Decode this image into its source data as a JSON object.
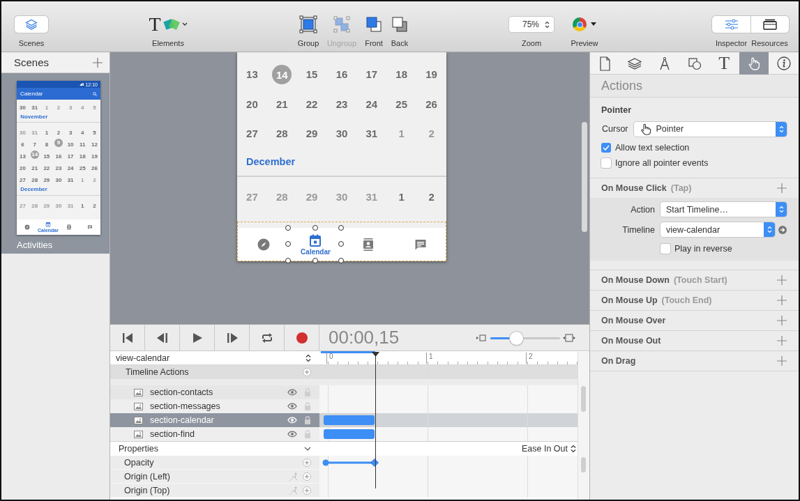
{
  "toolbar": {
    "scenes": {
      "label": "Scenes"
    },
    "elements": {
      "label": "Elements",
      "glyph": "T"
    },
    "arrange": [
      {
        "label": "Group",
        "kind": "group",
        "disabled": false
      },
      {
        "label": "Ungroup",
        "kind": "ungroup",
        "disabled": true
      },
      {
        "label": "Front",
        "kind": "front",
        "disabled": false
      },
      {
        "label": "Back",
        "kind": "back",
        "disabled": false
      }
    ],
    "zoom": {
      "label": "Zoom",
      "value": "75%"
    },
    "preview": {
      "label": "Preview"
    },
    "panels": [
      {
        "label": "Inspector",
        "kind": "inspector",
        "selected": true
      },
      {
        "label": "Resources",
        "kind": "resources",
        "selected": false
      }
    ]
  },
  "sidebar": {
    "title": "Scenes",
    "scenes": [
      {
        "name": "Activities",
        "selected": true,
        "thumbnail": {
          "time": "12:10",
          "title": "Calendar",
          "rows": [
            {
              "kind": "week",
              "days": [
                {
                  "day": "30",
                  "kind": "normal"
                },
                {
                  "day": "31",
                  "kind": "normal"
                },
                {
                  "day": "1",
                  "kind": "muted"
                },
                {
                  "day": "2",
                  "kind": "muted"
                },
                {
                  "day": "3",
                  "kind": "muted"
                },
                {
                  "day": "4",
                  "kind": "muted"
                },
                {
                  "day": "5",
                  "kind": "muted"
                }
              ]
            },
            {
              "kind": "month",
              "label": "November"
            },
            {
              "kind": "week",
              "days": [
                {
                  "day": "30",
                  "kind": "muted"
                },
                {
                  "day": "31",
                  "kind": "muted"
                },
                {
                  "day": "1",
                  "kind": "normal"
                },
                {
                  "day": "2",
                  "kind": "normal"
                },
                {
                  "day": "3",
                  "kind": "normal"
                },
                {
                  "day": "4",
                  "kind": "normal"
                },
                {
                  "day": "5",
                  "kind": "normal"
                }
              ]
            },
            {
              "kind": "week",
              "days": [
                {
                  "day": "6",
                  "kind": "normal"
                },
                {
                  "day": "7",
                  "kind": "normal"
                },
                {
                  "day": "8",
                  "kind": "normal"
                },
                {
                  "day": "9",
                  "kind": "circled"
                },
                {
                  "day": "10",
                  "kind": "normal"
                },
                {
                  "day": "11",
                  "kind": "normal"
                },
                {
                  "day": "12",
                  "kind": "normal"
                }
              ]
            },
            {
              "kind": "week",
              "days": [
                {
                  "day": "13",
                  "kind": "normal"
                },
                {
                  "day": "14",
                  "kind": "circled"
                },
                {
                  "day": "15",
                  "kind": "normal"
                },
                {
                  "day": "16",
                  "kind": "normal"
                },
                {
                  "day": "17",
                  "kind": "normal"
                },
                {
                  "day": "18",
                  "kind": "normal"
                },
                {
                  "day": "19",
                  "kind": "normal"
                }
              ]
            },
            {
              "kind": "week",
              "days": [
                {
                  "day": "20",
                  "kind": "normal"
                },
                {
                  "day": "21",
                  "kind": "normal"
                },
                {
                  "day": "22",
                  "kind": "normal"
                },
                {
                  "day": "23",
                  "kind": "normal"
                },
                {
                  "day": "24",
                  "kind": "normal"
                },
                {
                  "day": "25",
                  "kind": "normal"
                },
                {
                  "day": "26",
                  "kind": "normal"
                }
              ]
            },
            {
              "kind": "week",
              "days": [
                {
                  "day": "27",
                  "kind": "normal"
                },
                {
                  "day": "28",
                  "kind": "normal"
                },
                {
                  "day": "29",
                  "kind": "normal"
                },
                {
                  "day": "30",
                  "kind": "normal"
                },
                {
                  "day": "31",
                  "kind": "normal"
                },
                {
                  "day": "1",
                  "kind": "muted"
                },
                {
                  "day": "2",
                  "kind": "muted"
                }
              ]
            },
            {
              "kind": "month",
              "label": "December"
            },
            {
              "kind": "week",
              "days": [
                {
                  "day": "27",
                  "kind": "muted"
                },
                {
                  "day": "28",
                  "kind": "muted"
                },
                {
                  "day": "29",
                  "kind": "muted"
                },
                {
                  "day": "30",
                  "kind": "muted"
                },
                {
                  "day": "31",
                  "kind": "muted"
                },
                {
                  "day": "1",
                  "kind": "normal"
                },
                {
                  "day": "2",
                  "kind": "normal"
                }
              ]
            }
          ],
          "tabs": [
            {
              "kind": "compass",
              "selected": false
            },
            {
              "kind": "calendar",
              "label": "Calendar",
              "selected": true
            },
            {
              "kind": "contacts",
              "selected": false
            },
            {
              "kind": "messages",
              "selected": false
            }
          ]
        }
      }
    ]
  },
  "canvas": {
    "rows": [
      {
        "kind": "week",
        "days": [
          {
            "day": "13",
            "kind": "normal"
          },
          {
            "day": "14",
            "kind": "circled"
          },
          {
            "day": "15",
            "kind": "normal"
          },
          {
            "day": "16",
            "kind": "normal"
          },
          {
            "day": "17",
            "kind": "normal"
          },
          {
            "day": "18",
            "kind": "normal"
          },
          {
            "day": "19",
            "kind": "normal"
          }
        ]
      },
      {
        "kind": "week",
        "days": [
          {
            "day": "20",
            "kind": "normal"
          },
          {
            "day": "21",
            "kind": "normal"
          },
          {
            "day": "22",
            "kind": "normal"
          },
          {
            "day": "23",
            "kind": "normal"
          },
          {
            "day": "24",
            "kind": "normal"
          },
          {
            "day": "25",
            "kind": "normal"
          },
          {
            "day": "26",
            "kind": "normal"
          }
        ]
      },
      {
        "kind": "week",
        "days": [
          {
            "day": "27",
            "kind": "normal"
          },
          {
            "day": "28",
            "kind": "normal"
          },
          {
            "day": "29",
            "kind": "normal"
          },
          {
            "day": "30",
            "kind": "normal"
          },
          {
            "day": "31",
            "kind": "normal"
          },
          {
            "day": "1",
            "kind": "muted"
          },
          {
            "day": "2",
            "kind": "muted"
          }
        ]
      },
      {
        "kind": "month",
        "label": "December"
      },
      {
        "kind": "week",
        "days": [
          {
            "day": "27",
            "kind": "muted"
          },
          {
            "day": "28",
            "kind": "muted"
          },
          {
            "day": "29",
            "kind": "muted"
          },
          {
            "day": "30",
            "kind": "muted"
          },
          {
            "day": "31",
            "kind": "muted"
          },
          {
            "day": "1",
            "kind": "normal"
          },
          {
            "day": "2",
            "kind": "normal"
          }
        ]
      }
    ],
    "tabs": [
      {
        "kind": "compass",
        "selected": false
      },
      {
        "kind": "calendar",
        "label": "Calendar",
        "selected": true
      },
      {
        "kind": "contacts",
        "selected": false
      },
      {
        "kind": "messages",
        "selected": false
      }
    ]
  },
  "timeline": {
    "controls": [
      {
        "kind": "first"
      },
      {
        "kind": "previous"
      },
      {
        "kind": "play"
      },
      {
        "kind": "next"
      },
      {
        "kind": "loop"
      },
      {
        "kind": "record"
      }
    ],
    "time": "00:00,15",
    "zoom": {
      "level": 0.37
    },
    "playback": {
      "level": 0.215
    },
    "name": "view-calendar",
    "ruler": [
      "0",
      "1",
      "2"
    ],
    "actions_label": "Timeline Actions",
    "layers": [
      {
        "name": "section-contacts",
        "selected": false,
        "visible": true,
        "locked": false,
        "animated": false
      },
      {
        "name": "section-messages",
        "selected": false,
        "visible": true,
        "locked": false,
        "animated": false
      },
      {
        "name": "section-calendar",
        "selected": true,
        "visible": true,
        "locked": false,
        "animated": true
      },
      {
        "name": "section-find",
        "selected": false,
        "visible": true,
        "locked": false,
        "animated": true
      }
    ],
    "properties_label": "Properties",
    "easing": "Ease In Out",
    "properties": [
      {
        "name": "Opacity",
        "kind": "value",
        "keyframed": true
      },
      {
        "name": "Origin (Left)",
        "kind": "position",
        "keyframed": false
      },
      {
        "name": "Origin (Top)",
        "kind": "position",
        "keyframed": false
      }
    ]
  },
  "inspector": {
    "tabs": [
      {
        "kind": "document",
        "selected": false
      },
      {
        "kind": "layers",
        "selected": false
      },
      {
        "kind": "compass",
        "selected": false
      },
      {
        "kind": "shapes",
        "selected": false
      },
      {
        "kind": "text",
        "glyph": "T",
        "selected": false
      },
      {
        "kind": "actions",
        "selected": true
      },
      {
        "kind": "info",
        "selected": false
      }
    ],
    "title": "Actions",
    "pointer": {
      "title": "Pointer",
      "cursor_label": "Cursor",
      "cursor_value": "Pointer",
      "options": [
        {
          "label": "Allow text selection",
          "checked": true
        },
        {
          "label": "Ignore all pointer events",
          "checked": false
        }
      ]
    },
    "events": [
      {
        "name": "On Mouse Click",
        "hint": "(Tap)",
        "expanded": true,
        "action_label": "Action",
        "action_value": "Start Timeline…",
        "timeline_label": "Timeline",
        "timeline_value": "view-calendar",
        "reverse": {
          "label": "Play in reverse",
          "checked": false
        }
      },
      {
        "name": "On Mouse Down",
        "hint": "(Touch Start)",
        "expanded": false
      },
      {
        "name": "On Mouse Up",
        "hint": "(Touch End)",
        "expanded": false
      },
      {
        "name": "On Mouse Over",
        "expanded": false
      },
      {
        "name": "On Mouse Out",
        "expanded": false
      },
      {
        "name": "On Drag",
        "expanded": false
      }
    ]
  }
}
